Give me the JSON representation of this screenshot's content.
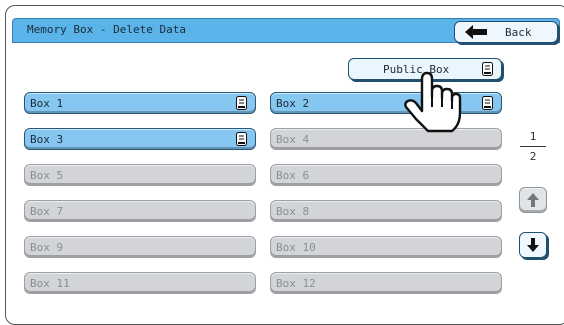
{
  "title": "Memory Box - Delete Data",
  "back_label": "Back",
  "public_box_label": "Public Box",
  "boxes": [
    {
      "label": "Box 1",
      "active": true
    },
    {
      "label": "Box 2",
      "active": true
    },
    {
      "label": "Box 3",
      "active": true
    },
    {
      "label": "Box 4",
      "active": false
    },
    {
      "label": "Box 5",
      "active": false
    },
    {
      "label": "Box 6",
      "active": false
    },
    {
      "label": "Box 7",
      "active": false
    },
    {
      "label": "Box 8",
      "active": false
    },
    {
      "label": "Box 9",
      "active": false
    },
    {
      "label": "Box 10",
      "active": false
    },
    {
      "label": "Box 11",
      "active": false
    },
    {
      "label": "Box 12",
      "active": false
    }
  ],
  "pager": {
    "current": "1",
    "total": "2"
  },
  "icons": {
    "back": "left-arrow-icon",
    "document": "document-icon",
    "scroll_up": "up-arrow-icon",
    "scroll_down": "down-arrow-icon",
    "pointer": "hand-pointer-icon"
  },
  "colors": {
    "titlebar": "#5ab4e9",
    "active_box": "#86c7f2",
    "inactive_box": "#d2d4d7",
    "border_dark": "#24506f"
  }
}
